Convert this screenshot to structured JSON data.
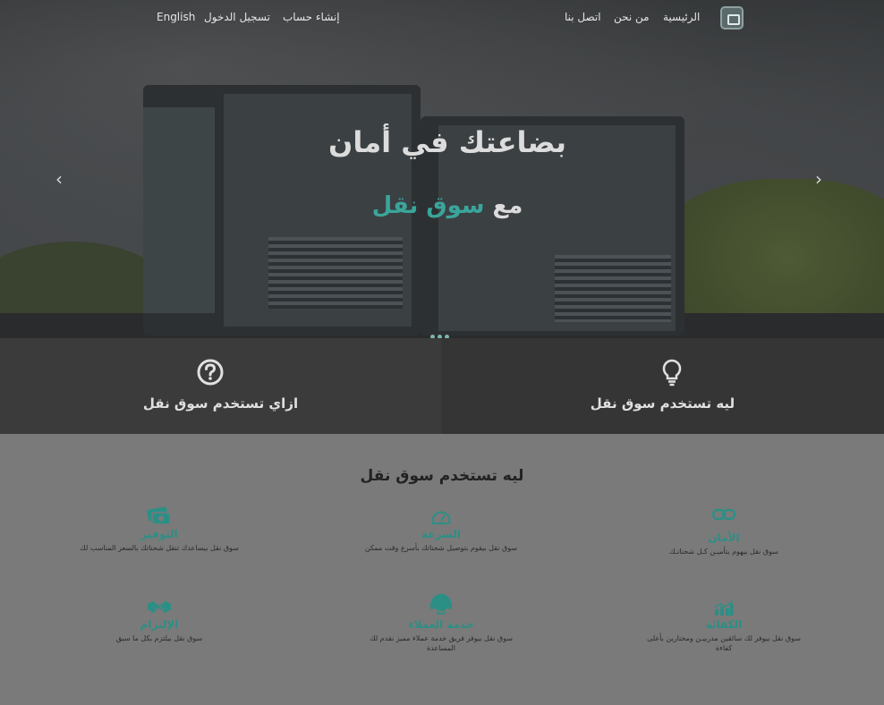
{
  "nav": {
    "home": "الرئيسية",
    "about": "من نحن",
    "contact": "اتصل بنا",
    "register": "إنشاء حساب",
    "login": "تسجيل الدخول",
    "language": "English"
  },
  "hero": {
    "title": "بضاعتك في أمان",
    "subtitle_prefix": "مع ",
    "subtitle_accent": "سوق نقل",
    "prev_arrow": "‹",
    "next_arrow": "›",
    "slide_count": 3
  },
  "panels": {
    "how": "ازاي تستخدم سوق نقل",
    "why": "ليه تستخدم سوق نقل"
  },
  "features_section": {
    "title": "ليه تستخدم سوق نقل",
    "items": [
      {
        "name": "الأمان",
        "desc": "سوق نقل بيهوم بتأميـن كـل شحناتـك",
        "icon": "chain-link-icon"
      },
      {
        "name": "السرعة",
        "desc": "سوق نقل بيقوم بتوصيل شحناتك بأسرع وقت ممكن",
        "icon": "speedometer-icon"
      },
      {
        "name": "التوفير",
        "desc": "سوق نقل بيساعدك تنقل شحناتك بالسعر المناسب لك",
        "icon": "money-icon"
      },
      {
        "name": "الكفائة",
        "desc": "سوق نقل بيوفر لك سائقين مدربيـن ومختارين بأعلى كفاءة",
        "icon": "chart-icon"
      },
      {
        "name": "خدمة العملاء",
        "desc": "سوق نقل بيوفر فريق خدمة عملاء مميز نقدم لك المساعدة",
        "icon": "headset-icon"
      },
      {
        "name": "الإلتزام",
        "desc": "سوق نقل بيلتزم بكل ما سبق",
        "icon": "handshake-icon"
      }
    ]
  },
  "colors": {
    "accent": "#3aa59a",
    "panel_dark": "#353535",
    "page_bg": "#7a7a7a"
  }
}
